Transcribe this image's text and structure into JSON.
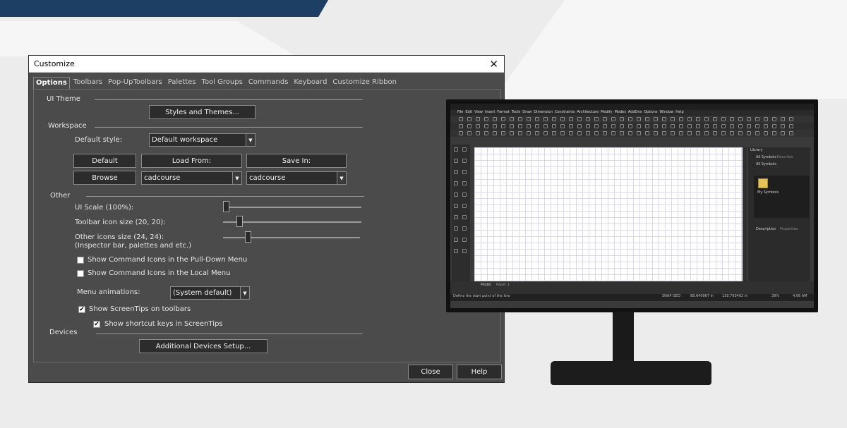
{
  "window": {
    "title": "Customize"
  },
  "tabs": [
    "Options",
    "Toolbars",
    "Pop-UpToolbars",
    "Palettes",
    "Tool Groups",
    "Commands",
    "Keyboard",
    "Customize Ribbon"
  ],
  "ui_theme": {
    "section": "UI Theme",
    "styles_button": "Styles and Themes..."
  },
  "workspace": {
    "section": "Workspace",
    "default_style_label": "Default style:",
    "default_style_value": "Default workspace",
    "default_button": "Default",
    "load_from_button": "Load From:",
    "save_in_button": "Save In:",
    "browse_button": "Browse",
    "load_from_value": "cadcourse",
    "save_in_value": "cadcourse"
  },
  "other": {
    "section": "Other",
    "ui_scale_label": "UI Scale (100%):",
    "toolbar_icon_label": "Toolbar icon size (20, 20):",
    "other_icons_label_1": "Other icons size (24, 24):",
    "other_icons_label_2": "(Inspector bar, palettes and etc.)",
    "ui_scale_level": 0.0,
    "toolbar_icon_level": 0.1,
    "other_icons_level": 0.17,
    "show_icons_pulldown": {
      "label": "Show Command Icons in the Pull-Down Menu",
      "checked": false
    },
    "show_icons_local": {
      "label": "Show Command Icons in the Local Menu",
      "checked": false
    },
    "menu_animations_label": "Menu animations:",
    "menu_animations_value": "(System default)",
    "show_screentips": {
      "label": "Show ScreenTips on toolbars",
      "checked": true
    },
    "show_shortcut_keys": {
      "label": "Show shortcut keys in ScreenTips",
      "checked": true
    }
  },
  "devices": {
    "section": "Devices",
    "setup_button": "Additional Devices Setup..."
  },
  "footer": {
    "close_button": "Close",
    "help_button": "Help"
  },
  "glyphs": {
    "close": "✕",
    "dropdown": "▼",
    "check": "✔"
  },
  "monitor_screen": {
    "menu_items": [
      "File",
      "Edit",
      "View",
      "Insert",
      "Format",
      "Tools",
      "Draw",
      "Dimension",
      "Constraints",
      "Architecture",
      "Modify",
      "Modes",
      "AddOns",
      "Options",
      "Window",
      "Help"
    ],
    "library_title": "Library",
    "library_tab_1": "All Symbols",
    "library_tab_2": "Favorites",
    "library_filter": "All Symbols",
    "folder_label": "My Symbols",
    "description_tab": "Description",
    "properties_tab": "Properties",
    "model_tab": "Model",
    "paper_tab": "Paper 1",
    "status_text": "Define the start point of the line",
    "snap": "SNAP GEO",
    "coord_x": "88.640967 in",
    "coord_y": "130.793402 in",
    "zoom": "39%",
    "time": "4:06 AM"
  }
}
